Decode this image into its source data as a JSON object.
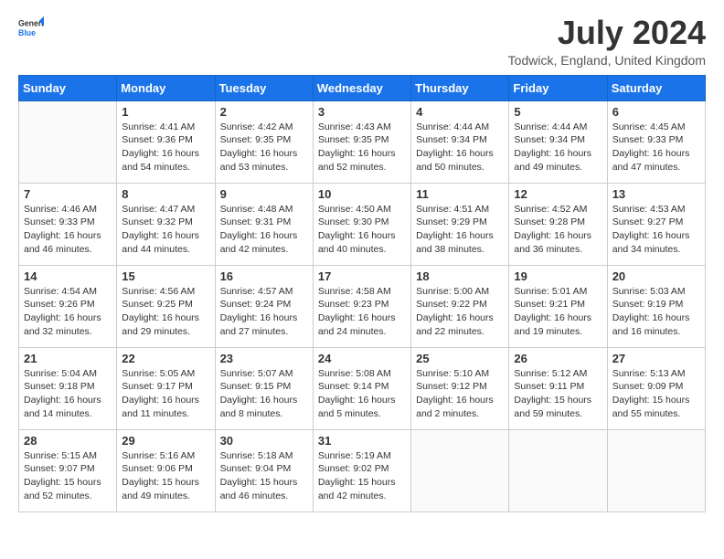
{
  "header": {
    "logo_general": "General",
    "logo_blue": "Blue",
    "month_title": "July 2024",
    "location": "Todwick, England, United Kingdom"
  },
  "days_of_week": [
    "Sunday",
    "Monday",
    "Tuesday",
    "Wednesday",
    "Thursday",
    "Friday",
    "Saturday"
  ],
  "weeks": [
    [
      {
        "day": "",
        "info": ""
      },
      {
        "day": "1",
        "info": "Sunrise: 4:41 AM\nSunset: 9:36 PM\nDaylight: 16 hours\nand 54 minutes."
      },
      {
        "day": "2",
        "info": "Sunrise: 4:42 AM\nSunset: 9:35 PM\nDaylight: 16 hours\nand 53 minutes."
      },
      {
        "day": "3",
        "info": "Sunrise: 4:43 AM\nSunset: 9:35 PM\nDaylight: 16 hours\nand 52 minutes."
      },
      {
        "day": "4",
        "info": "Sunrise: 4:44 AM\nSunset: 9:34 PM\nDaylight: 16 hours\nand 50 minutes."
      },
      {
        "day": "5",
        "info": "Sunrise: 4:44 AM\nSunset: 9:34 PM\nDaylight: 16 hours\nand 49 minutes."
      },
      {
        "day": "6",
        "info": "Sunrise: 4:45 AM\nSunset: 9:33 PM\nDaylight: 16 hours\nand 47 minutes."
      }
    ],
    [
      {
        "day": "7",
        "info": "Sunrise: 4:46 AM\nSunset: 9:33 PM\nDaylight: 16 hours\nand 46 minutes."
      },
      {
        "day": "8",
        "info": "Sunrise: 4:47 AM\nSunset: 9:32 PM\nDaylight: 16 hours\nand 44 minutes."
      },
      {
        "day": "9",
        "info": "Sunrise: 4:48 AM\nSunset: 9:31 PM\nDaylight: 16 hours\nand 42 minutes."
      },
      {
        "day": "10",
        "info": "Sunrise: 4:50 AM\nSunset: 9:30 PM\nDaylight: 16 hours\nand 40 minutes."
      },
      {
        "day": "11",
        "info": "Sunrise: 4:51 AM\nSunset: 9:29 PM\nDaylight: 16 hours\nand 38 minutes."
      },
      {
        "day": "12",
        "info": "Sunrise: 4:52 AM\nSunset: 9:28 PM\nDaylight: 16 hours\nand 36 minutes."
      },
      {
        "day": "13",
        "info": "Sunrise: 4:53 AM\nSunset: 9:27 PM\nDaylight: 16 hours\nand 34 minutes."
      }
    ],
    [
      {
        "day": "14",
        "info": "Sunrise: 4:54 AM\nSunset: 9:26 PM\nDaylight: 16 hours\nand 32 minutes."
      },
      {
        "day": "15",
        "info": "Sunrise: 4:56 AM\nSunset: 9:25 PM\nDaylight: 16 hours\nand 29 minutes."
      },
      {
        "day": "16",
        "info": "Sunrise: 4:57 AM\nSunset: 9:24 PM\nDaylight: 16 hours\nand 27 minutes."
      },
      {
        "day": "17",
        "info": "Sunrise: 4:58 AM\nSunset: 9:23 PM\nDaylight: 16 hours\nand 24 minutes."
      },
      {
        "day": "18",
        "info": "Sunrise: 5:00 AM\nSunset: 9:22 PM\nDaylight: 16 hours\nand 22 minutes."
      },
      {
        "day": "19",
        "info": "Sunrise: 5:01 AM\nSunset: 9:21 PM\nDaylight: 16 hours\nand 19 minutes."
      },
      {
        "day": "20",
        "info": "Sunrise: 5:03 AM\nSunset: 9:19 PM\nDaylight: 16 hours\nand 16 minutes."
      }
    ],
    [
      {
        "day": "21",
        "info": "Sunrise: 5:04 AM\nSunset: 9:18 PM\nDaylight: 16 hours\nand 14 minutes."
      },
      {
        "day": "22",
        "info": "Sunrise: 5:05 AM\nSunset: 9:17 PM\nDaylight: 16 hours\nand 11 minutes."
      },
      {
        "day": "23",
        "info": "Sunrise: 5:07 AM\nSunset: 9:15 PM\nDaylight: 16 hours\nand 8 minutes."
      },
      {
        "day": "24",
        "info": "Sunrise: 5:08 AM\nSunset: 9:14 PM\nDaylight: 16 hours\nand 5 minutes."
      },
      {
        "day": "25",
        "info": "Sunrise: 5:10 AM\nSunset: 9:12 PM\nDaylight: 16 hours\nand 2 minutes."
      },
      {
        "day": "26",
        "info": "Sunrise: 5:12 AM\nSunset: 9:11 PM\nDaylight: 15 hours\nand 59 minutes."
      },
      {
        "day": "27",
        "info": "Sunrise: 5:13 AM\nSunset: 9:09 PM\nDaylight: 15 hours\nand 55 minutes."
      }
    ],
    [
      {
        "day": "28",
        "info": "Sunrise: 5:15 AM\nSunset: 9:07 PM\nDaylight: 15 hours\nand 52 minutes."
      },
      {
        "day": "29",
        "info": "Sunrise: 5:16 AM\nSunset: 9:06 PM\nDaylight: 15 hours\nand 49 minutes."
      },
      {
        "day": "30",
        "info": "Sunrise: 5:18 AM\nSunset: 9:04 PM\nDaylight: 15 hours\nand 46 minutes."
      },
      {
        "day": "31",
        "info": "Sunrise: 5:19 AM\nSunset: 9:02 PM\nDaylight: 15 hours\nand 42 minutes."
      },
      {
        "day": "",
        "info": ""
      },
      {
        "day": "",
        "info": ""
      },
      {
        "day": "",
        "info": ""
      }
    ]
  ]
}
